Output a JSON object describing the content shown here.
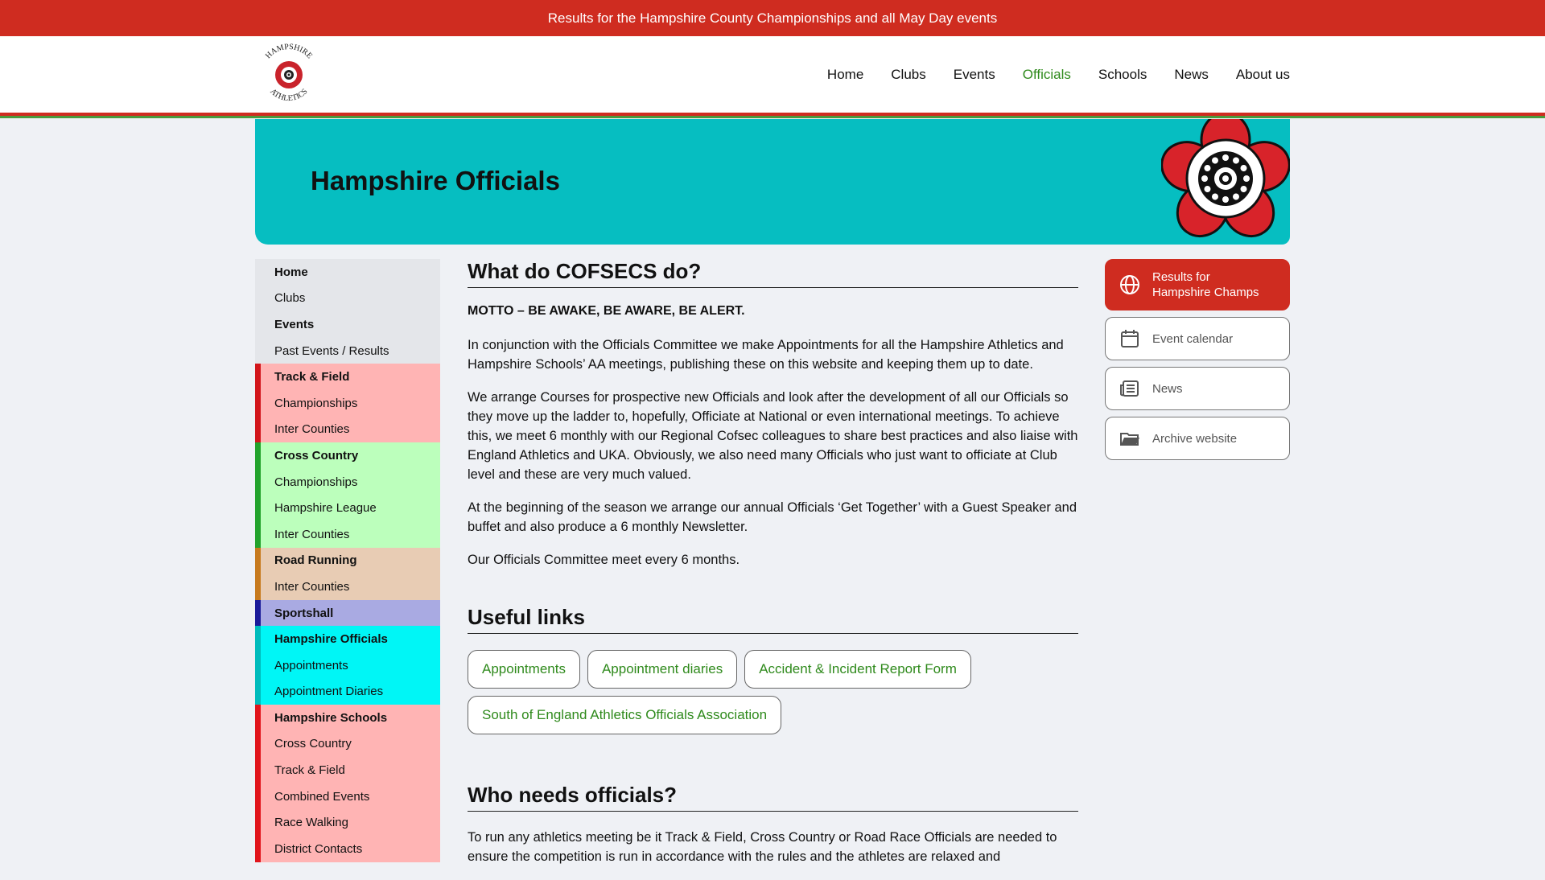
{
  "topbar": {
    "text": "Results for the Hampshire County Championships and all May Day events"
  },
  "header": {
    "logo_text_top": "HAMPSHIRE",
    "logo_text_bottom": "ATHLETICS",
    "nav": [
      {
        "label": "Home",
        "active": false
      },
      {
        "label": "Clubs",
        "active": false
      },
      {
        "label": "Events",
        "active": false
      },
      {
        "label": "Officials",
        "active": true
      },
      {
        "label": "Schools",
        "active": false
      },
      {
        "label": "News",
        "active": false
      },
      {
        "label": "About us",
        "active": false
      }
    ]
  },
  "banner": {
    "title": "Hampshire Officials"
  },
  "sidebar": {
    "items": [
      {
        "label": "Home",
        "bold": true,
        "group": "home"
      },
      {
        "label": "Clubs",
        "bold": false,
        "group": "home"
      },
      {
        "label": "Events",
        "bold": true,
        "group": "home"
      },
      {
        "label": "Past Events / Results",
        "bold": false,
        "group": "home"
      },
      {
        "label": "Track & Field",
        "bold": true,
        "group": "track"
      },
      {
        "label": "Championships",
        "bold": false,
        "group": "track"
      },
      {
        "label": "Inter Counties",
        "bold": false,
        "group": "track"
      },
      {
        "label": "Cross Country",
        "bold": true,
        "group": "xc"
      },
      {
        "label": "Championships",
        "bold": false,
        "group": "xc"
      },
      {
        "label": "Hampshire League",
        "bold": false,
        "group": "xc"
      },
      {
        "label": "Inter Counties",
        "bold": false,
        "group": "xc"
      },
      {
        "label": "Road Running",
        "bold": true,
        "group": "road"
      },
      {
        "label": "Inter Counties",
        "bold": false,
        "group": "road"
      },
      {
        "label": "Sportshall",
        "bold": true,
        "group": "sport"
      },
      {
        "label": "Hampshire Officials",
        "bold": true,
        "group": "off"
      },
      {
        "label": "Appointments",
        "bold": false,
        "group": "off"
      },
      {
        "label": "Appointment Diaries",
        "bold": false,
        "group": "off"
      },
      {
        "label": "Hampshire Schools",
        "bold": true,
        "group": "sch"
      },
      {
        "label": "Cross Country",
        "bold": false,
        "group": "sch"
      },
      {
        "label": "Track & Field",
        "bold": false,
        "group": "sch"
      },
      {
        "label": "Combined Events",
        "bold": false,
        "group": "sch"
      },
      {
        "label": "Race Walking",
        "bold": false,
        "group": "sch"
      },
      {
        "label": "District Contacts",
        "bold": false,
        "group": "sch"
      }
    ]
  },
  "main": {
    "heading1": "What do COFSECS do?",
    "motto": "MOTTO – BE AWAKE, BE AWARE, BE ALERT.",
    "paragraphs": [
      "In conjunction with the Officials Committee we make Appointments for all the Hampshire Athletics and Hampshire Schools’ AA meetings, publishing these on this website and keeping them up to date.",
      "We arrange Courses for prospective new Officials and look after the development of all our Officials so they move up the ladder to, hopefully, Officiate at National or even international meetings. To achieve this, we meet 6 monthly with our Regional Cofsec colleagues to share best practices and also liaise with England Athletics and UKA. Obviously, we also need many Officials who just want to officiate at Club level and these are very much valued.",
      "At the beginning of the season we arrange our annual Officials ‘Get Together’ with a Guest Speaker and buffet and also produce a 6 monthly Newsletter.",
      "Our Officials Committee meet every 6 months."
    ],
    "heading2": "Useful links",
    "links": [
      "Appointments",
      "Appointment diaries",
      "Accident & Incident Report Form",
      "South of England Athletics Officials Association"
    ],
    "heading3": "Who needs officials?",
    "para_last": "To run any athletics meeting be it Track & Field, Cross Country or Road Race Officials are needed to ensure the competition is run in accordance with the rules and the athletes are relaxed and"
  },
  "rightcol": {
    "results_label_1": "Results for",
    "results_label_2": "Hampshire Champs",
    "calendar_label": "Event calendar",
    "news_label": "News",
    "archive_label": "Archive website"
  },
  "colors": {
    "brand_red": "#cf2c20",
    "accent_green": "#2f8a1c",
    "banner_teal": "#06bec1"
  }
}
